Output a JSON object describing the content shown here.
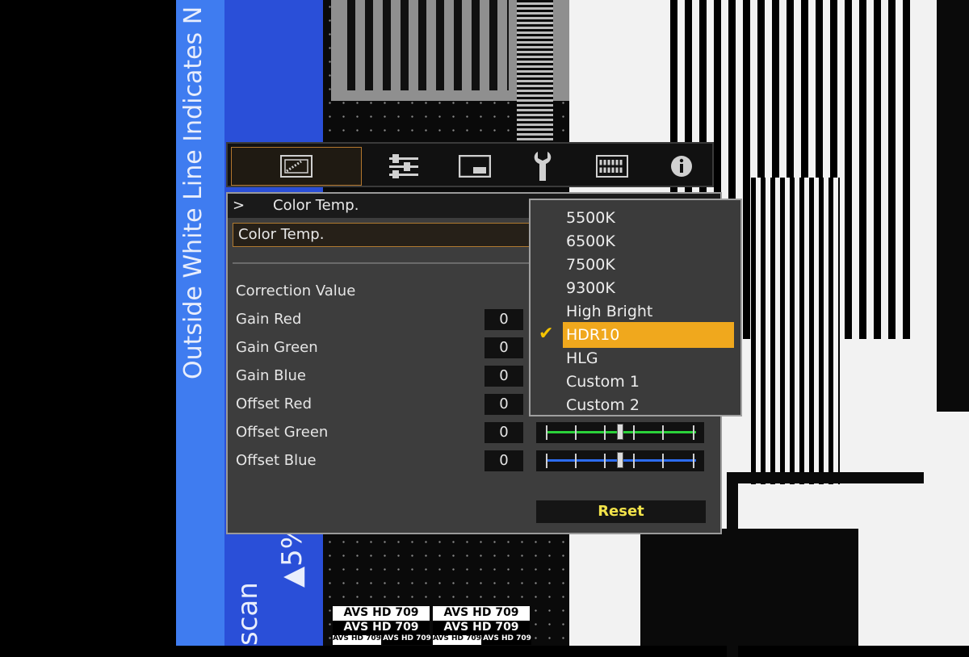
{
  "background": {
    "side_text": "Outside White Line Indicates N",
    "percent_text": "▲5%",
    "scan_text": "scan",
    "pattern_label": "AVS HD 709"
  },
  "osd": {
    "tabs": [
      {
        "name": "picture",
        "icon": "picture-icon",
        "active": true
      },
      {
        "name": "adjust",
        "icon": "sliders-icon",
        "active": false
      },
      {
        "name": "screen",
        "icon": "screen-icon",
        "active": false
      },
      {
        "name": "settings",
        "icon": "wrench-icon",
        "active": false
      },
      {
        "name": "network",
        "icon": "grid-icon",
        "active": false
      },
      {
        "name": "info",
        "icon": "info-icon",
        "active": false
      }
    ],
    "breadcrumb_arrow": ">",
    "breadcrumb": "Color Temp.",
    "selected_setting": "Color Temp.",
    "correction_label": "Correction Value",
    "rows": [
      {
        "label": "Gain Red",
        "value": "0",
        "color": "#e23a3a"
      },
      {
        "label": "Gain Green",
        "value": "0",
        "color": "#2bd23a"
      },
      {
        "label": "Gain Blue",
        "value": "0",
        "color": "#2d6cf0"
      },
      {
        "label": "Offset Red",
        "value": "0",
        "color": "#e23a3a"
      },
      {
        "label": "Offset Green",
        "value": "0",
        "color": "#2bd23a"
      },
      {
        "label": "Offset Blue",
        "value": "0",
        "color": "#2d6cf0"
      }
    ],
    "reset_label": "Reset",
    "accent_color": "#f0a81d",
    "reset_color": "#f1e24a"
  },
  "dropdown": {
    "options": [
      "5500K",
      "6500K",
      "7500K",
      "9300K",
      "High Bright",
      "HDR10",
      "HLG",
      "Custom 1",
      "Custom 2"
    ],
    "selected": "HDR10",
    "check_mark": "✔"
  }
}
